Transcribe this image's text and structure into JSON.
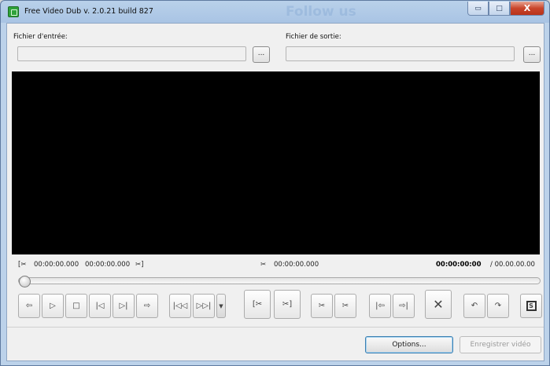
{
  "window": {
    "title": "Free Video Dub  v. 2.0.21 build 827",
    "background_text": "Follow us",
    "controls": {
      "minimize": "▭",
      "maximize": "□",
      "close": "X"
    }
  },
  "input": {
    "label": "Fichier d'entrée:",
    "value": "",
    "browse_label": "..."
  },
  "output": {
    "label": "Fichier de sortie:",
    "value": "",
    "browse_label": "..."
  },
  "timeline": {
    "cut_start_icon": "[✂",
    "cut_start_time": "00:00:00.000",
    "cut_end_time": "00:00:00.000",
    "cut_end_icon": "✂]",
    "cursor_icon": "✂",
    "cursor_time": "00:00:00.000",
    "current_time": "00:00:00:00",
    "total_time": "/ 00.00.00.00",
    "position": 0
  },
  "toolbar": {
    "prev_frame": "⇦",
    "play": "▷",
    "stop": "□",
    "step_back": "|◁",
    "step_forward": "▷|",
    "next_frame": "⇨",
    "go_start": "|◁◁",
    "go_end": "▷▷|",
    "dropdown": "▼",
    "mark_start": "[✂",
    "mark_end": "✂]",
    "mark_cut": "✂",
    "remove_cut": "✂",
    "prev_mark": "|⇦",
    "next_mark": "⇨|",
    "clear": "✕",
    "undo": "↶",
    "redo": "↷",
    "snapshot": "S"
  },
  "footer": {
    "options_label": "Options...",
    "save_label": "Enregistrer vidéo"
  }
}
